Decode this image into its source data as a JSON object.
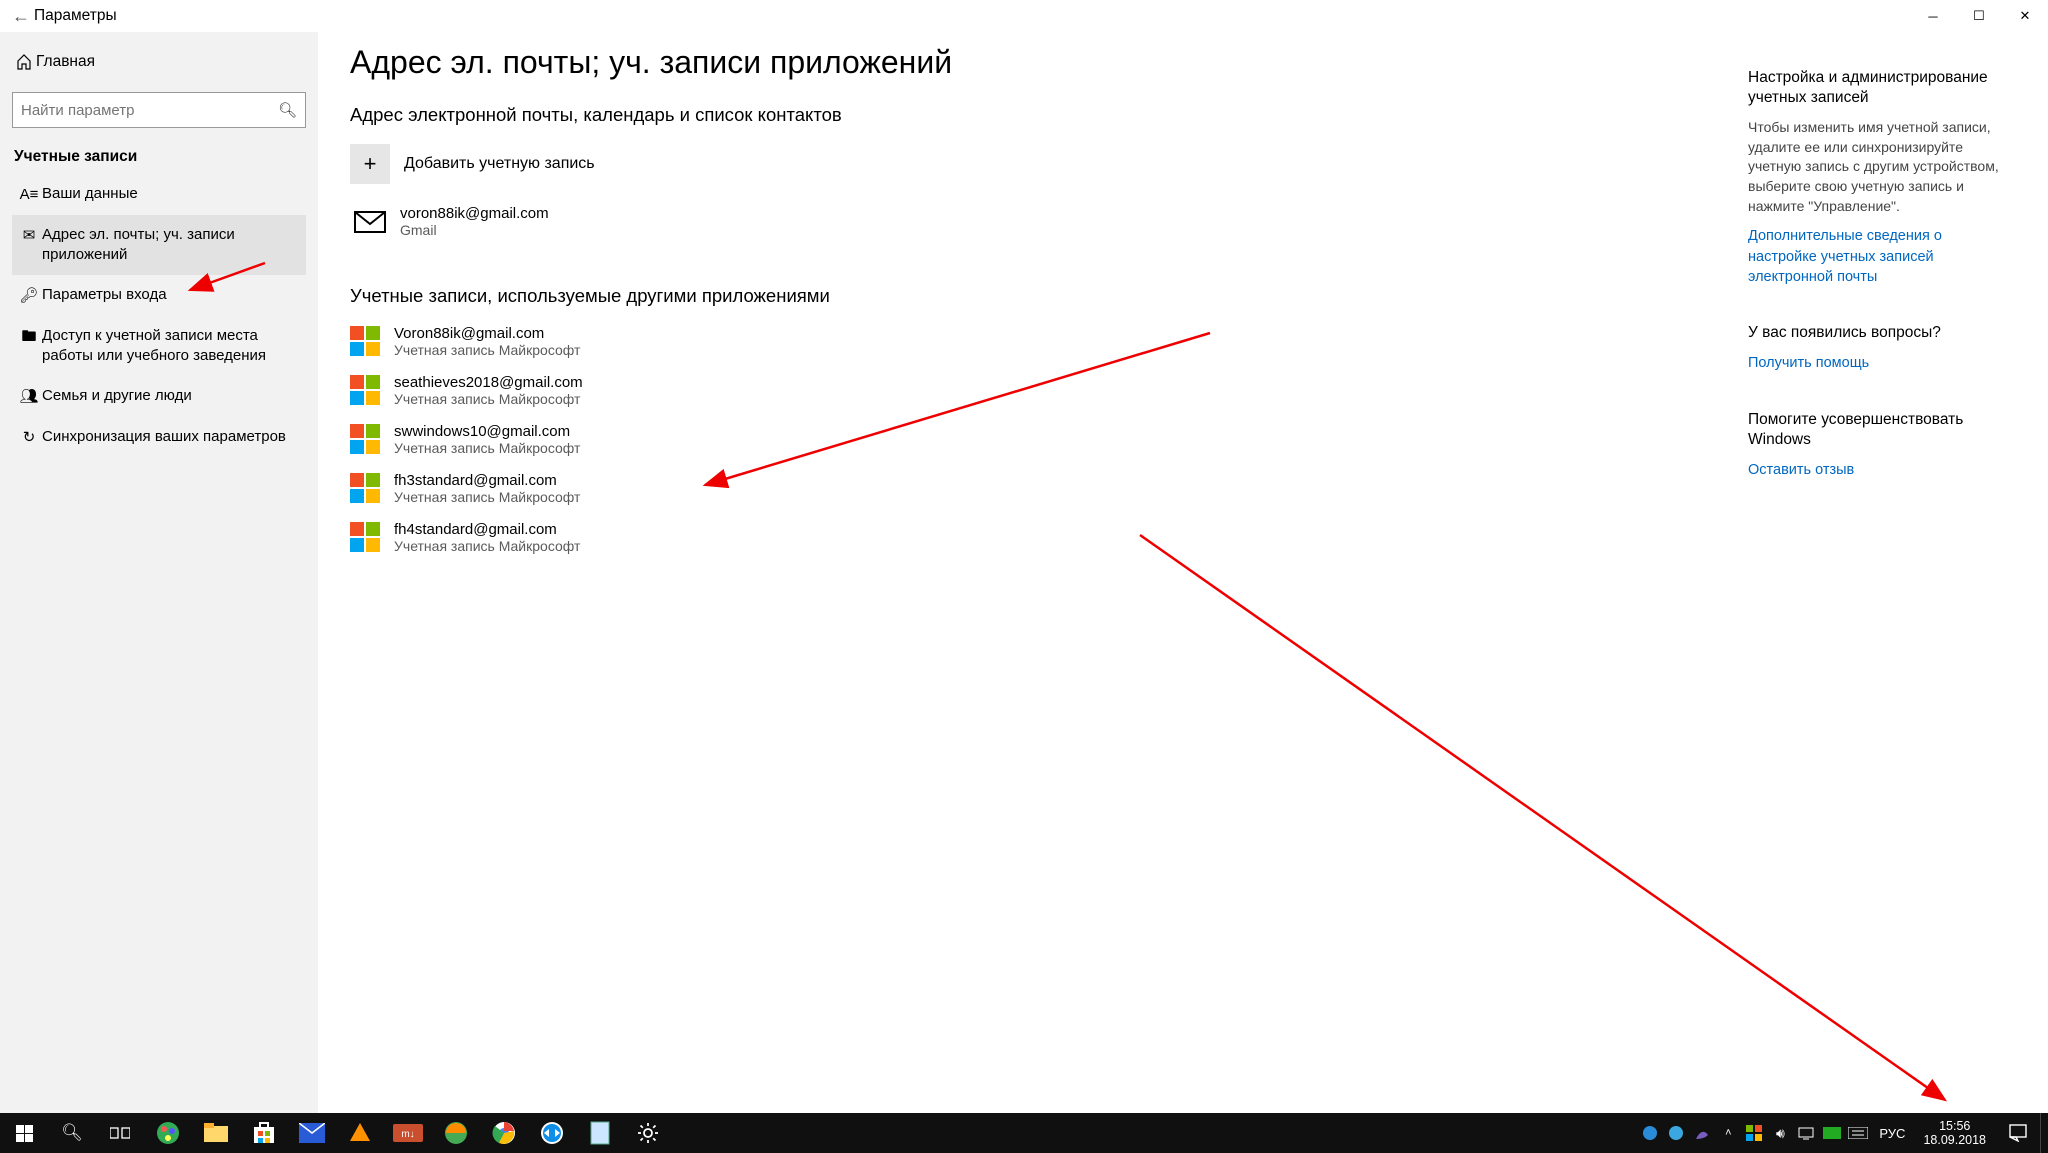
{
  "window": {
    "title": "Параметры"
  },
  "sidebar": {
    "home": "Главная",
    "search_placeholder": "Найти параметр",
    "heading": "Учетные записи",
    "items": [
      {
        "label": "Ваши данные"
      },
      {
        "label": "Адрес эл. почты; уч. записи приложений"
      },
      {
        "label": "Параметры входа"
      },
      {
        "label": "Доступ к учетной записи места работы или учебного заведения"
      },
      {
        "label": "Семья и другие люди"
      },
      {
        "label": "Синхронизация ваших параметров"
      }
    ]
  },
  "main": {
    "page_title": "Адрес эл. почты; уч. записи приложений",
    "section1_heading": "Адрес электронной почты, календарь и список контактов",
    "add_account": "Добавить учетную запись",
    "email_account": {
      "address": "voron88ik@gmail.com",
      "provider": "Gmail"
    },
    "section2_heading": "Учетные записи, используемые другими приложениями",
    "ms_label": "Учетная запись Майкрософт",
    "accounts": [
      {
        "email": "Voron88ik@gmail.com"
      },
      {
        "email": "seathieves2018@gmail.com"
      },
      {
        "email": "swwindows10@gmail.com"
      },
      {
        "email": "fh3standard@gmail.com"
      },
      {
        "email": "fh4standard@gmail.com"
      }
    ]
  },
  "rightpanel": {
    "admin_head": "Настройка и администрирование учетных записей",
    "admin_body": "Чтобы изменить имя учетной записи, удалите ее или синхронизируйте учетную запись с другим устройством, выберите свою учетную запись и нажмите \"Управление\".",
    "admin_link": "Дополнительные сведения о настройке учетных записей электронной почты",
    "q_head": "У вас появились вопросы?",
    "q_link": "Получить помощь",
    "f_head": "Помогите усовершенствовать Windows",
    "f_link": "Оставить отзыв"
  },
  "taskbar": {
    "lang": "РУС",
    "time": "15:56",
    "date": "18.09.2018"
  }
}
